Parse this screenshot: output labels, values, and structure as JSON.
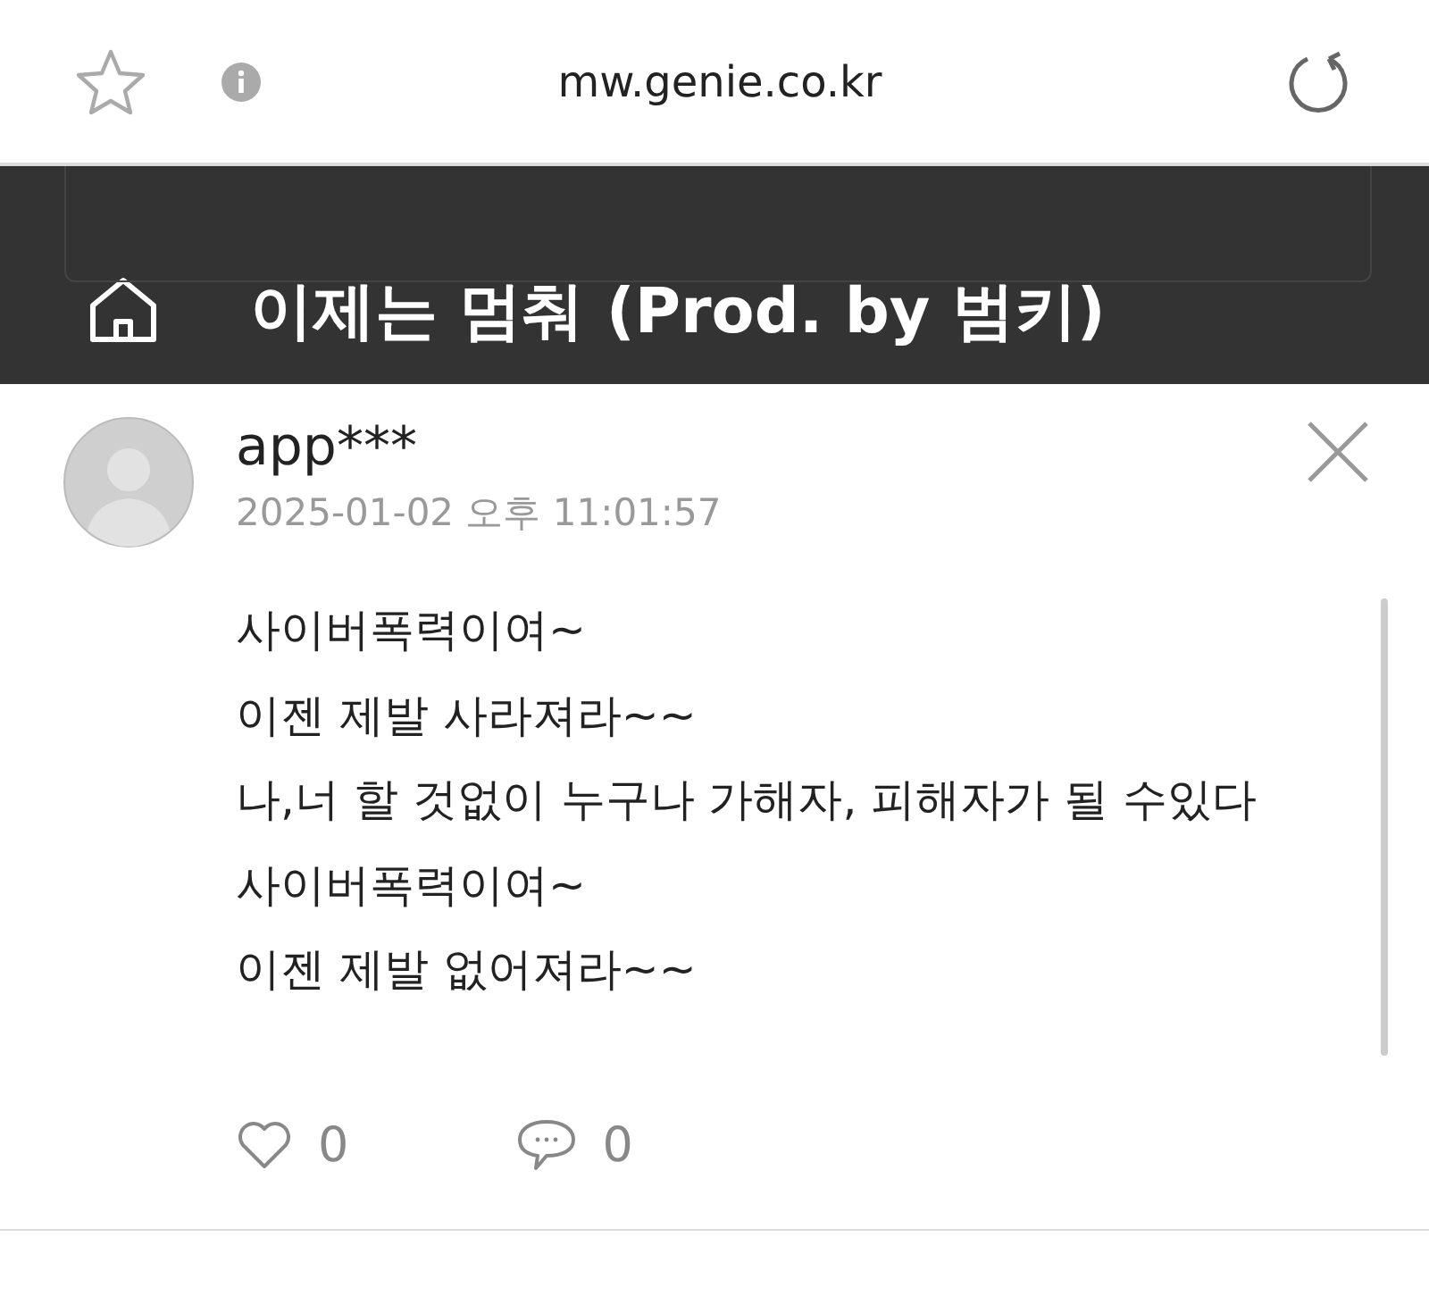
{
  "browser": {
    "url": "mw.genie.co.kr"
  },
  "header": {
    "title": "이제는 멈춰 (Prod. by 범키)"
  },
  "comment": {
    "user": "app***",
    "date": "2025-01-02 오후 11:01:57",
    "lines": [
      "사이버폭력이여~",
      "이젠 제발 사라져라~~",
      "나,너 할 것없이 누구나 가해자, 피해자가 될 수있다",
      "사이버폭력이여~",
      "이젠 제발 없어져라~~"
    ],
    "likes": "0",
    "replies": "0"
  }
}
